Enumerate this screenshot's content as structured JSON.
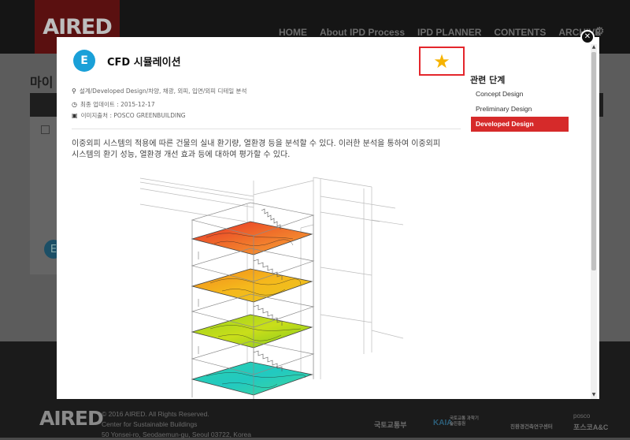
{
  "header": {
    "logo": "AIRED",
    "nav": [
      "HOME",
      "About IPD Process",
      "IPD PLANNER",
      "CONTENTS",
      "ARCHIVE"
    ]
  },
  "page": {
    "title": "마이"
  },
  "footer": {
    "logo": "AIRED",
    "copyright": "© 2016 AIRED. All Rights Reserved.",
    "org": "Center for Sustainable Buildings",
    "address": "50 Yonsei-ro, Seodaemun-gu, Seoul 03722, Korea",
    "partners": [
      "국토교통부",
      "KAIA",
      "국토교통 과학기술진흥원",
      "친환경건축연구센터",
      "posco",
      "포스코A&C"
    ]
  },
  "modal": {
    "badge": "E",
    "title": "CFD 시뮬레이션",
    "category": "설계/Developed Design/차양, 채광, 외피, 입면/외피 디테일 분석",
    "updated": "최종 업데이트 : 2015-12-17",
    "image_source": "이미지출처 : POSCO GREENBUILDING",
    "description": "이중외피 시스템의 적용에 따른 건물의 실내 환기량, 열환경 등을 분석할 수 있다. 이러한 분석을 통하여 이중외피 시스템의 환기 성능, 열환경 개선 효과 등에 대하여 평가할 수 있다.",
    "close_label": "✕",
    "favorite_icon": "star-icon"
  },
  "sidebar": {
    "title": "관련 단계",
    "items": [
      {
        "label": "Concept Design",
        "active": false
      },
      {
        "label": "Preliminary Design",
        "active": false
      },
      {
        "label": "Developed Design",
        "active": true
      }
    ]
  },
  "colors": {
    "accent_red": "#d62a2a",
    "badge_blue": "#1aa0d8",
    "star": "#f6b300",
    "highlight_border": "#e4262c"
  }
}
